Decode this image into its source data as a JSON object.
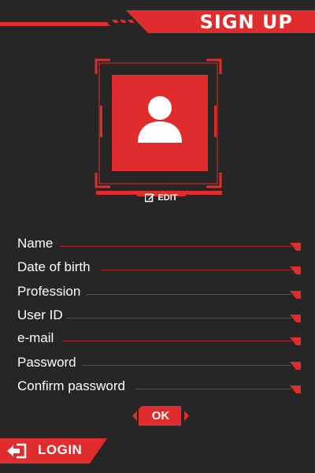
{
  "header": {
    "title": "SIGN UP"
  },
  "avatar": {
    "edit_label": "EDIT"
  },
  "form": {
    "fields": [
      {
        "label": "Name"
      },
      {
        "label": "Date of birth"
      },
      {
        "label": "Profession"
      },
      {
        "label": "User ID"
      },
      {
        "label": "e-mail"
      },
      {
        "label": "Password"
      },
      {
        "label": "Confirm password"
      }
    ]
  },
  "actions": {
    "ok_label": "OK",
    "login_label": "LOGIN"
  },
  "colors": {
    "accent": "#e02c2c",
    "background": "#262626",
    "line": "#b5272c"
  }
}
